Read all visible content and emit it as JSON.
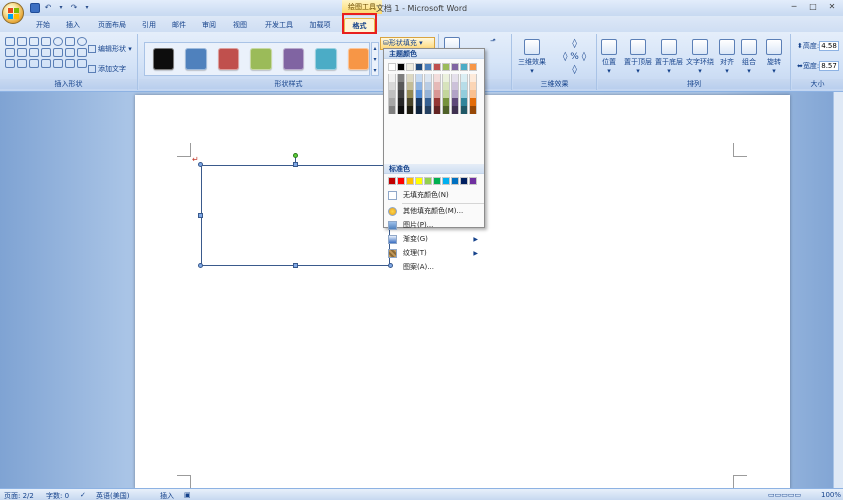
{
  "window": {
    "title": "文档 1 - Microsoft Word",
    "contextual_tab_group": "绘图工具"
  },
  "quick_access": {
    "save": "save-icon",
    "undo": "↶",
    "redo": "↷"
  },
  "tabs": [
    {
      "label": "开始"
    },
    {
      "label": "插入"
    },
    {
      "label": "页面布局"
    },
    {
      "label": "引用"
    },
    {
      "label": "邮件"
    },
    {
      "label": "审阅"
    },
    {
      "label": "视图"
    },
    {
      "label": "开发工具"
    },
    {
      "label": "加载项"
    },
    {
      "label": "格式",
      "active": true
    }
  ],
  "ribbon": {
    "insert_shapes": {
      "label": "插入形状",
      "edit_shape": "编辑形状",
      "add_text": "添加文字"
    },
    "shape_styles": {
      "label": "形状样式",
      "swatches": [
        "#0d0d0d",
        "#4f81bd",
        "#c0504d",
        "#9bbb59",
        "#8064a2",
        "#4bacc6",
        "#f79646"
      ],
      "fill_button": "形状填充"
    },
    "shadow_label": "",
    "three_d": {
      "label": "三维效果",
      "button": "三维效果"
    },
    "arrange": {
      "label": "排列",
      "buttons": [
        "位置",
        "置于顶层",
        "置于底层",
        "文字环绕",
        "对齐",
        "组合",
        "旋转"
      ]
    },
    "size": {
      "label": "大小",
      "height_label": "高度:",
      "height_value": "4.58",
      "width_label": "宽度:",
      "width_value": "8.57"
    }
  },
  "dropdown": {
    "theme_colors_label": "主题颜色",
    "theme_top": [
      "#ffffff",
      "#000000",
      "#eeece1",
      "#1f497d",
      "#4f81bd",
      "#c0504d",
      "#9bbb59",
      "#8064a2",
      "#4bacc6",
      "#f79646"
    ],
    "theme_tints": [
      [
        "#f2f2f2",
        "#d9d9d9",
        "#bfbfbf",
        "#a6a6a6",
        "#808080"
      ],
      [
        "#7f7f7f",
        "#595959",
        "#404040",
        "#262626",
        "#0d0d0d"
      ],
      [
        "#ddd9c3",
        "#c4bd97",
        "#948a54",
        "#4a452a",
        "#1d1b10"
      ],
      [
        "#c6d9f0",
        "#8db3e2",
        "#548dd4",
        "#17365d",
        "#0f243e"
      ],
      [
        "#dbe5f1",
        "#b8cce4",
        "#95b3d7",
        "#366092",
        "#244061"
      ],
      [
        "#f2dcdb",
        "#e5b9b7",
        "#d99694",
        "#953734",
        "#632423"
      ],
      [
        "#ebf1dd",
        "#d7e3bc",
        "#c3d69b",
        "#76923c",
        "#4f6128"
      ],
      [
        "#e5e0ec",
        "#ccc1d9",
        "#b2a2c7",
        "#5f497a",
        "#3f3151"
      ],
      [
        "#dbeef3",
        "#b7dde8",
        "#92cddc",
        "#31859b",
        "#205867"
      ],
      [
        "#fdeada",
        "#fbd5b5",
        "#fac08f",
        "#e36c09",
        "#974806"
      ]
    ],
    "standard_colors_label": "标准色",
    "standard_colors": [
      "#c00000",
      "#ff0000",
      "#ffc000",
      "#ffff00",
      "#92d050",
      "#00b050",
      "#00b0f0",
      "#0070c0",
      "#002060",
      "#7030a0"
    ],
    "items": {
      "no_fill": "无填充颜色(N)",
      "more_colors": "其他填充颜色(M)...",
      "picture": "图片(P)...",
      "gradient": "渐变(G)",
      "texture": "纹理(T)",
      "pattern": "图案(A)..."
    }
  },
  "statusbar": {
    "page": "页面: 2/2",
    "words": "字数: 0",
    "language": "英语(美国)",
    "mode": "插入",
    "zoom": "100%"
  }
}
